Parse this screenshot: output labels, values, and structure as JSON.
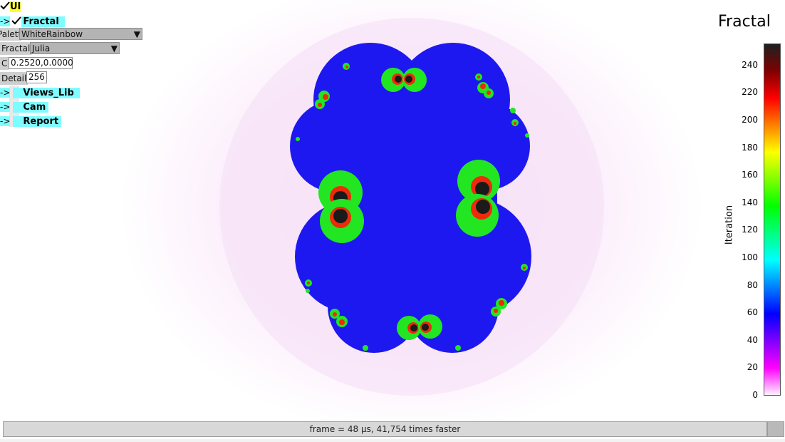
{
  "panel": {
    "ui_label": "UI",
    "arrow": "->",
    "fractal_label": "Fractal",
    "palette": {
      "label": "Palett",
      "value": "WhiteRainbow"
    },
    "fractal_type": {
      "label": "Fractal",
      "value": "Julia"
    },
    "c": {
      "label": "C",
      "value": "0.2520,0.0000"
    },
    "detail": {
      "label": "Detail",
      "value": "256"
    },
    "sections": [
      "Views_Lib",
      "Cam",
      "Report"
    ]
  },
  "colorbar": {
    "title": "Fractal",
    "axis_label": "Iteration",
    "ticks": [
      "0",
      "20",
      "40",
      "60",
      "80",
      "100",
      "120",
      "140",
      "160",
      "180",
      "200",
      "220",
      "240"
    ],
    "range": [
      0,
      256
    ],
    "stops": [
      "#fff0ff",
      "#ff00ff",
      "#8000ff",
      "#0000ff",
      "#0080ff",
      "#00ffff",
      "#00ff80",
      "#00ff00",
      "#80ff00",
      "#ffff00",
      "#ff8000",
      "#ff0000",
      "#800000",
      "#202020"
    ]
  },
  "status": {
    "text": "frame = 48 µs, 41,754 times faster"
  },
  "colors": {
    "body_blue": "#1e18f0",
    "halo": "#fbe9fb",
    "green": "#22e622",
    "red": "#ee2a0c",
    "dark": "#1a1a1a"
  }
}
